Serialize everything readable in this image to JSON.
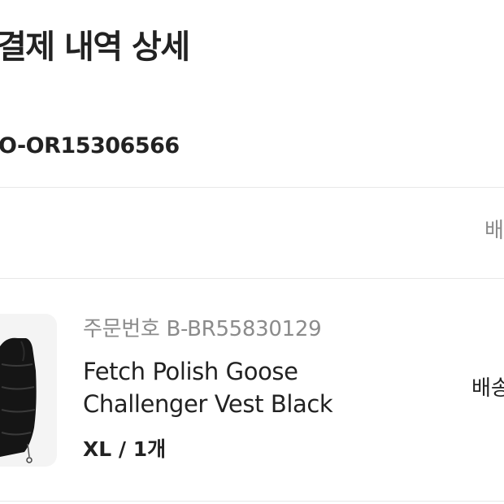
{
  "header": {
    "title": "결제 내역 상세"
  },
  "order": {
    "order_id": "O-OR15306566",
    "status_partial": "배"
  },
  "product": {
    "image_icon": "vest-product-image",
    "order_number": "주문번호 B-BR55830129",
    "name_line1": "Fetch Polish Goose",
    "name_line2": "Challenger Vest Black",
    "option": "XL / 1개",
    "delivery_partial": "배송"
  }
}
